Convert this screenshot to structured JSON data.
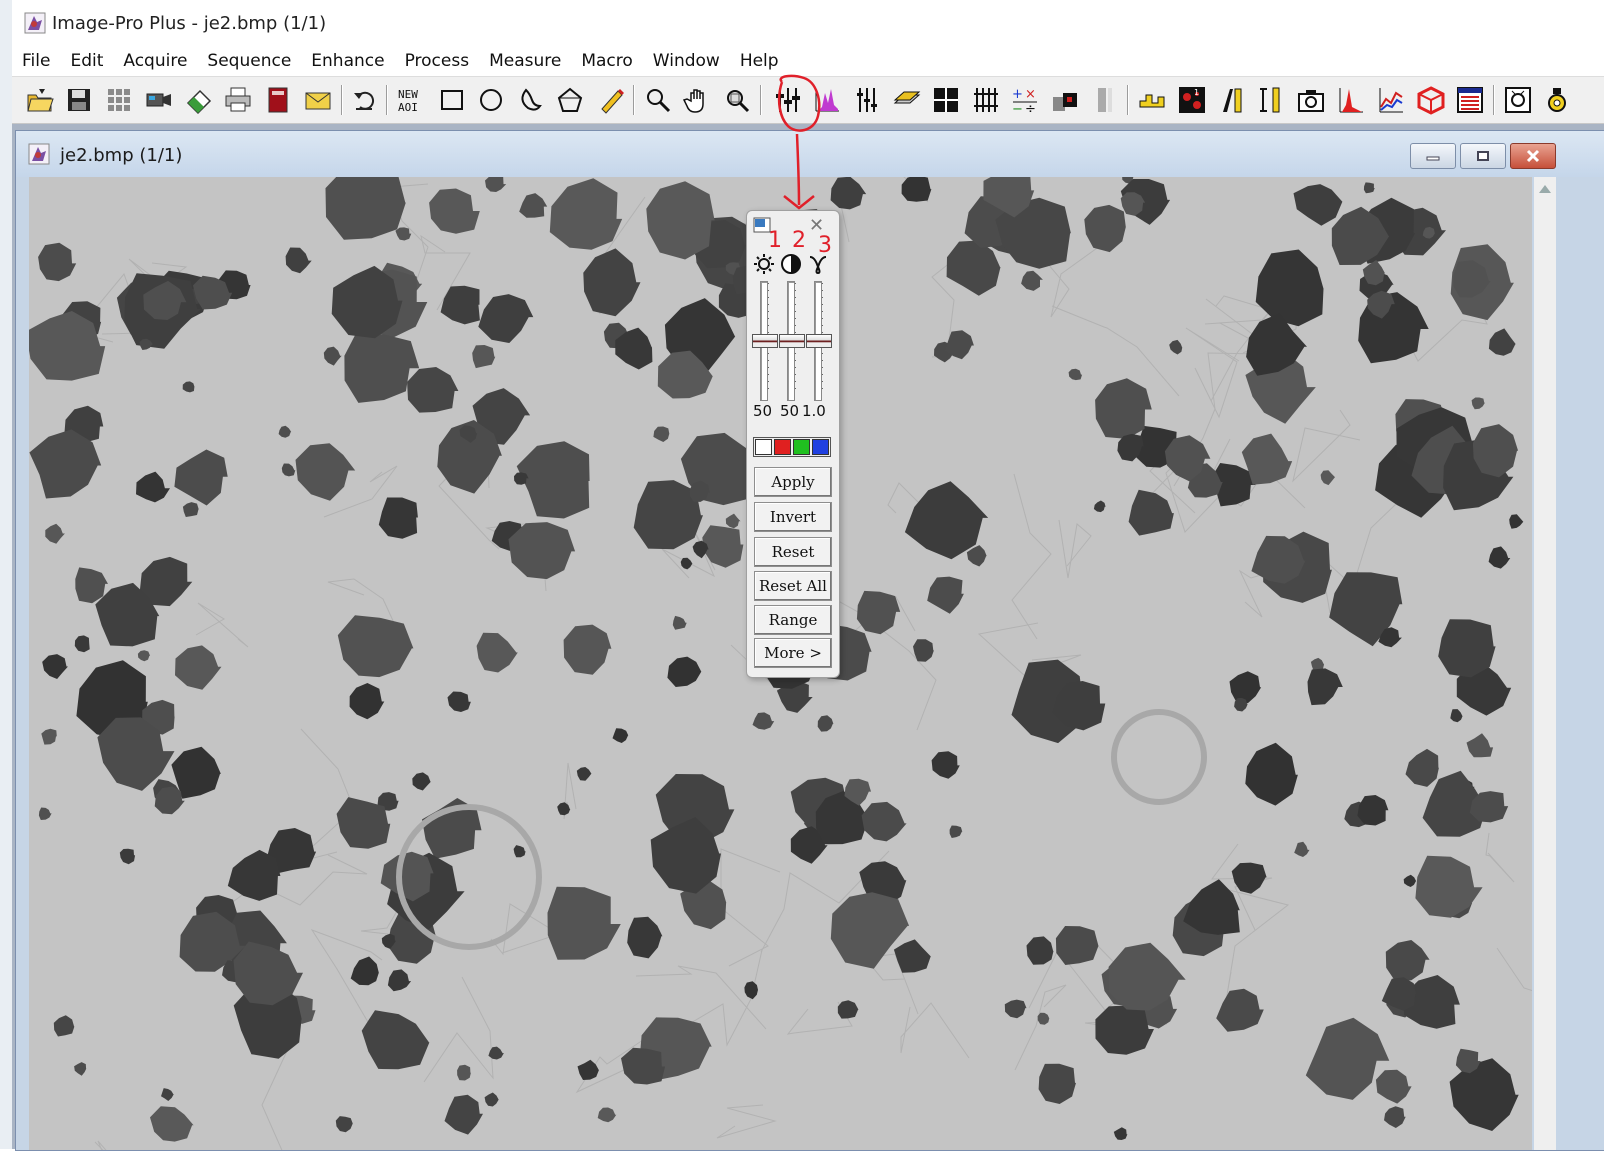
{
  "window": {
    "title": "Image-Pro Plus - je2.bmp (1/1)"
  },
  "menu": [
    "File",
    "Edit",
    "Acquire",
    "Sequence",
    "Enhance",
    "Process",
    "Measure",
    "Macro",
    "Window",
    "Help"
  ],
  "toolbar": {
    "new_aoi_label": "NEW\nAOI"
  },
  "document": {
    "title": "je2.bmp (1/1)"
  },
  "bcg_panel": {
    "values": [
      "50",
      "50",
      "1.0"
    ],
    "buttons": [
      "Apply",
      "Invert",
      "Reset",
      "Reset All",
      "Range",
      "More >"
    ],
    "channel_colors": [
      "#ffffff",
      "#e02020",
      "#20c020",
      "#2040e0"
    ],
    "slider_levels": [
      0.5,
      0.5,
      0.5
    ]
  },
  "annotations": {
    "labels": [
      "1",
      "2",
      "3"
    ],
    "color": "#e0202a"
  }
}
